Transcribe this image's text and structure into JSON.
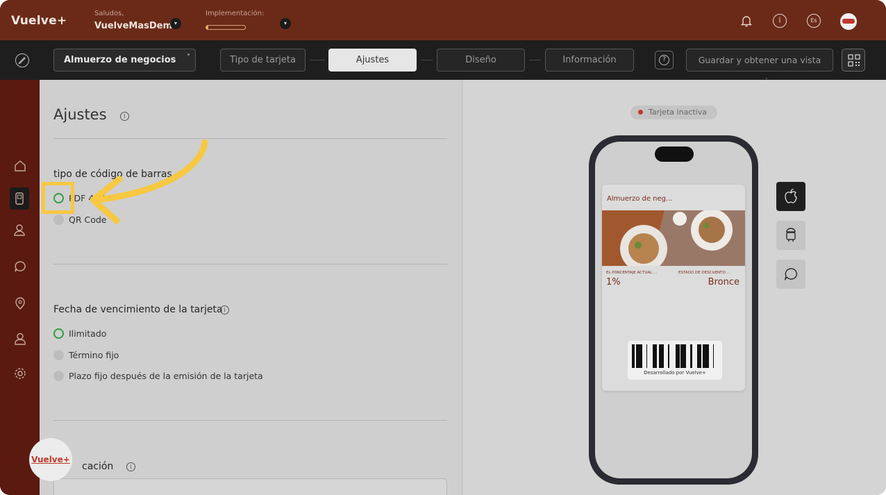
{
  "header": {
    "logo": "Vuelve+",
    "greeting_label": "Saludos,",
    "user_name": "VuelveMasDemo",
    "implementation_label": "Implementación:",
    "implementation_progress": 0.06,
    "info_icon_glyph": "i",
    "lang_icon_glyph": "Es"
  },
  "nav": {
    "card_name": "Almuerzo de negocios",
    "steps": [
      "Tipo de tarjeta",
      "Ajustes",
      "Diseño",
      "Información"
    ],
    "active_step": "Ajustes",
    "help_glyph": "?",
    "save_label": "Guardar y obtener una vista previa"
  },
  "settings": {
    "title": "Ajustes",
    "barcode_section": {
      "title": "tipo de código de barras",
      "options": [
        "PDF 417",
        "QR Code"
      ],
      "selected": "PDF 417"
    },
    "expiry_section": {
      "title": "Fecha de vencimiento de la tarjeta",
      "options": [
        "Ilimitado",
        "Término fijo",
        "Plazo fijo después de la emisión de la tarjeta"
      ],
      "selected": "Ilimitado"
    },
    "location_section": {
      "title": "cación"
    }
  },
  "preview": {
    "status": "Tarjeta inactiva",
    "card_title": "Almuerzo de neg...",
    "field1_label": "EL PORCENTAJE ACTUAL ...",
    "field1_value": "1%",
    "field2_label": "ESTADO DE DESCUENTO ...",
    "field2_value": "Bronce",
    "barcode_caption": "Desarrollado por Vuelve+"
  },
  "brand_bubble": "Vuelve+",
  "colors": {
    "brand": "#6b2a18",
    "sidebar": "#5a1a10",
    "selected_radio": "#2ea043",
    "highlight": "#f7c842",
    "inactive_dot": "#c0392b"
  },
  "icons": {
    "sidebar": [
      "home-icon",
      "card-icon",
      "customers-icon",
      "chat-icon",
      "location-icon",
      "user-icon",
      "settings-icon"
    ],
    "os_toggles": [
      "apple-icon",
      "android-icon",
      "message-icon"
    ]
  }
}
